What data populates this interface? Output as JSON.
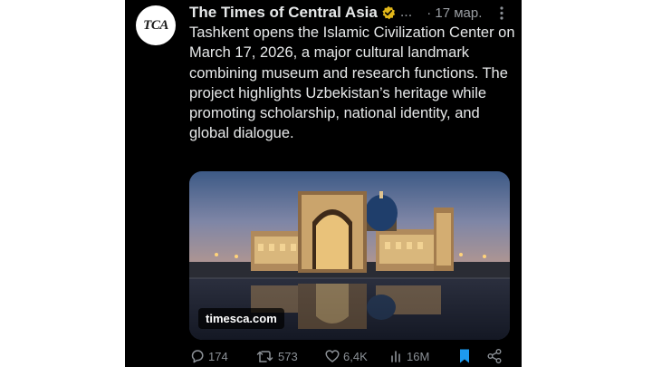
{
  "post": {
    "author": "The Times of Central Asia",
    "avatar_text": "TCA",
    "ellipsis": "...",
    "date": "· 17 мар.",
    "text": "Tashkent opens the Islamic Civilization Center on March 17, 2026, a major cultural landmark combining museum and research functions. The project highlights Uzbekistan’s heritage while promoting scholarship, national identity, and global dialogue.",
    "link_domain": "timesca.com"
  },
  "icons": {
    "verified": "verified-badge-icon",
    "more": "more-vertical-icon",
    "replies": "reply-icon",
    "reposts": "repost-icon",
    "likes": "heart-icon",
    "views": "views-icon",
    "bookmark": "bookmark-icon",
    "share": "share-icon"
  },
  "stats": {
    "replies": "174",
    "reposts": "573",
    "likes": "6,4K",
    "views": "16M"
  },
  "colors": {
    "background": "#000000",
    "text": "#e7e9ea",
    "muted": "#8b9096",
    "verified_gold": "#e2b719",
    "bookmark_active": "#1d9bf0"
  }
}
